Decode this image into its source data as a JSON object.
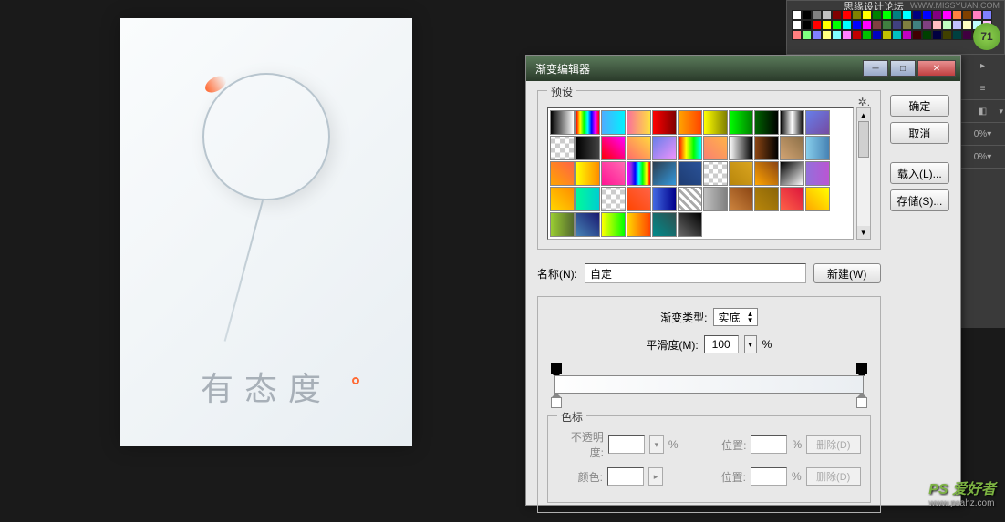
{
  "canvas": {
    "subtitle": "有态度"
  },
  "swatches": {
    "title": "思缘设计论坛",
    "url": "WWW.MISSYUAN.COM",
    "colors": [
      "#fff",
      "#000",
      "#808080",
      "#c0c0c0",
      "#800000",
      "#ff0000",
      "#808000",
      "#ffff00",
      "#008000",
      "#00ff00",
      "#008080",
      "#00ffff",
      "#000080",
      "#0000ff",
      "#800080",
      "#ff00ff",
      "#ff8040",
      "#804000",
      "#ff80c0",
      "#8080ff",
      "#fff",
      "#000",
      "#ff0000",
      "#ffff00",
      "#00ff00",
      "#00ffff",
      "#0000ff",
      "#ff00ff",
      "#804040",
      "#408040",
      "#404080",
      "#808040",
      "#408080",
      "#804080",
      "#ffc0c0",
      "#c0ffc0",
      "#c0c0ff",
      "#ffffc0",
      "#c0ffff",
      "#ffc0ff",
      "#ff8080",
      "#80ff80",
      "#8080ff",
      "#ffff80",
      "#80ffff",
      "#ff80ff",
      "#c00000",
      "#00c000",
      "#0000c0",
      "#c0c000",
      "#00c0c0",
      "#c000c0",
      "#400000",
      "#004000",
      "#000040",
      "#404000",
      "#004040",
      "#400040",
      "#200000",
      "#002000"
    ]
  },
  "badge": {
    "value": "71"
  },
  "dialog": {
    "title": "渐变编辑器",
    "presets_label": "预设",
    "buttons": {
      "ok": "确定",
      "cancel": "取消",
      "load": "载入(L)...",
      "save": "存储(S)..."
    },
    "name_label": "名称(N):",
    "name_value": "自定",
    "new_btn": "新建(W)",
    "grad_type_label": "渐变类型:",
    "grad_type_value": "实底",
    "smooth_label": "平滑度(M):",
    "smooth_value": "100",
    "smooth_unit": "%",
    "stops_label": "色标",
    "opacity_label": "不透明度:",
    "opacity_unit": "%",
    "position_label": "位置:",
    "position_unit": "%",
    "color_label": "颜色:",
    "delete_btn": "删除(D)"
  },
  "right_panel": {
    "opacity1": "0%",
    "opacity2": "0%"
  },
  "watermark": {
    "text": "PS 爱好者",
    "url": "www.psahz.com"
  },
  "preset_gradients": [
    "linear-gradient(90deg,#000,#fff)",
    "linear-gradient(90deg,#ff0000,#ffff00,#00ff00,#00ffff,#0000ff,#ff00ff,#ff0000)",
    "linear-gradient(90deg,#4facfe,#00f2fe)",
    "linear-gradient(90deg,#fa709a,#fee140)",
    "linear-gradient(90deg,#ff0000,#800000)",
    "linear-gradient(90deg,#ffa500,#ff4500)",
    "linear-gradient(90deg,#ffff00,#808000)",
    "linear-gradient(90deg,#00ff00,#008000)",
    "linear-gradient(90deg,#006400,#000)",
    "linear-gradient(90deg,#000,#fff,#000)",
    "linear-gradient(135deg,#667eea,#764ba2)",
    "repeating-conic-gradient(#ccc 0 25%,#fff 0 50%) 0/10px 10px",
    "linear-gradient(90deg,#000,#434343)",
    "linear-gradient(45deg,#ff0000,#ff00ff)",
    "linear-gradient(45deg,#ff6b6b,#ffd93d)",
    "linear-gradient(135deg,#667eea,#f093fb)",
    "linear-gradient(90deg,#ff0000,#ffff00,#00ff00,#00ffff)",
    "linear-gradient(45deg,#fa8072,#ffb347)",
    "linear-gradient(90deg,transparent,#000)",
    "linear-gradient(90deg,#8b4513,#000)",
    "linear-gradient(45deg,#d4a574,#8b6f47)",
    "linear-gradient(90deg,#87ceeb,#4682b4)",
    "linear-gradient(45deg,#ffa500,#ff6347)",
    "linear-gradient(90deg,#ffff00,#ff8c00)",
    "linear-gradient(45deg,#ff1493,#ff69b4)",
    "linear-gradient(90deg,#ff00ff,#8a2be2,#0000ff,#00ffff,#00ff00,#ffff00,#ff0000)",
    "linear-gradient(135deg,#2c3e50,#3498db)",
    "linear-gradient(45deg,#1e3c72,#2a5298)",
    "repeating-conic-gradient(#ccc 0 25%,#fff 0 50%) 0/10px 10px",
    "linear-gradient(45deg,#b8860b,#daa520)",
    "linear-gradient(45deg,#ffa500,#8b4513)",
    "linear-gradient(135deg,#000,#fff)",
    "linear-gradient(90deg,#9370db,#ba55d3)",
    "linear-gradient(45deg,#ffd700,#ff8c00)",
    "linear-gradient(90deg,#00fa9a,#00ced1)",
    "repeating-conic-gradient(#ccc 0 25%,#fff 0 50%) 0/10px 10px",
    "linear-gradient(45deg,#ff4500,#ff6347)",
    "linear-gradient(90deg,#4169e1,#00008b)",
    "repeating-linear-gradient(45deg,#fff,#fff 3px,#aaa 3px,#aaa 6px)",
    "linear-gradient(90deg,#c0c0c0,#808080)",
    "linear-gradient(45deg,#cd853f,#8b4513)",
    "linear-gradient(45deg,#b8860b,#8b6508)",
    "linear-gradient(45deg,#ff6347,#dc143c)",
    "linear-gradient(45deg,#ffa500,#ffff00)",
    "linear-gradient(90deg,#9acd32,#556b2f)",
    "linear-gradient(45deg,#4682b4,#191970)",
    "linear-gradient(90deg,#ffff00,#00ff00)",
    "linear-gradient(90deg,#ffd700,#ff8c00,#ff4500)",
    "linear-gradient(45deg,#008b8b,#2f4f4f)",
    "linear-gradient(45deg,#696969,#000)"
  ]
}
